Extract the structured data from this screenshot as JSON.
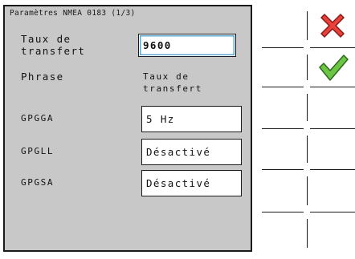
{
  "dialog": {
    "title": "Paramètres NMEA 0183 (1/3)",
    "baud_label": "Taux de\ntransfert",
    "baud_value": "9600",
    "col_sentence_label": "Phrase",
    "col_rate_label": "Taux de\ntransfert",
    "rows": [
      {
        "sentence": "GPGGA",
        "rate": "5 Hz"
      },
      {
        "sentence": "GPGLL",
        "rate": "Désactivé"
      },
      {
        "sentence": "GPGSA",
        "rate": "Désactivé"
      }
    ]
  },
  "softkeys": {
    "cancel_icon": "red-x-cross-icon",
    "confirm_icon": "green-check-icon",
    "colors": {
      "cancel": "#e8403a",
      "confirm": "#6cc644"
    }
  }
}
